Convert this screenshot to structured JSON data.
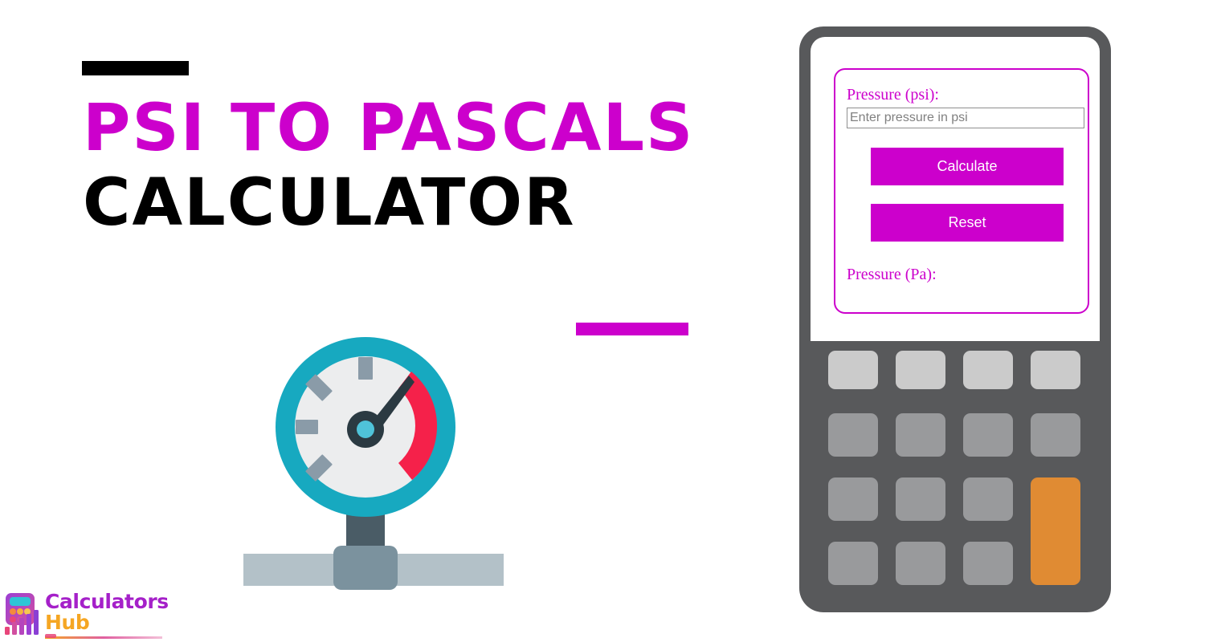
{
  "hero": {
    "title_line_1": "PSI TO PASCALS",
    "title_line_2": "CALCULATOR",
    "accent_bar_black_color": "#000000",
    "accent_bar_magenta_color": "#cc00cc",
    "title_accent_color": "#cc00cc",
    "title_base_color": "#000000"
  },
  "illustration": {
    "name": "pressure-gauge",
    "ring_color": "#17a9c0",
    "face_color": "#ecedee",
    "tick_color": "#8a9ba8",
    "danger_arc_color": "#f5214a",
    "needle_color": "#2b3a42",
    "needle_hub_color": "#3a4b54",
    "needle_center_color": "#4fc3d9",
    "stem_color": "#4a5c66",
    "valve_color": "#7b929e",
    "pipe_color": "#b3c1c8"
  },
  "logo": {
    "word_1": "Calculators",
    "word_2": "Hub",
    "word_1_color": "#a520c9",
    "word_2_color": "#f5a623",
    "icon_name": "calculator-bar-chart-icon"
  },
  "calculator": {
    "body_color": "#58595b",
    "screen_color": "#ffffff",
    "panel_border_color": "#cc00cc",
    "fields": {
      "psi_label": "Pressure (psi):",
      "psi_placeholder": "Enter pressure in psi",
      "psi_value": "",
      "pa_label": "Pressure (Pa):",
      "pa_value": ""
    },
    "buttons": {
      "calculate_label": "Calculate",
      "reset_label": "Reset",
      "button_color": "#cc00cc",
      "button_text_color": "#ffffff"
    },
    "keypad": {
      "rows": 4,
      "columns": 4,
      "key_light_color": "#cbcbcb",
      "key_default_color": "#999a9c",
      "key_accent_color": "#e08b33",
      "accent_key_span_rows": 2
    }
  }
}
